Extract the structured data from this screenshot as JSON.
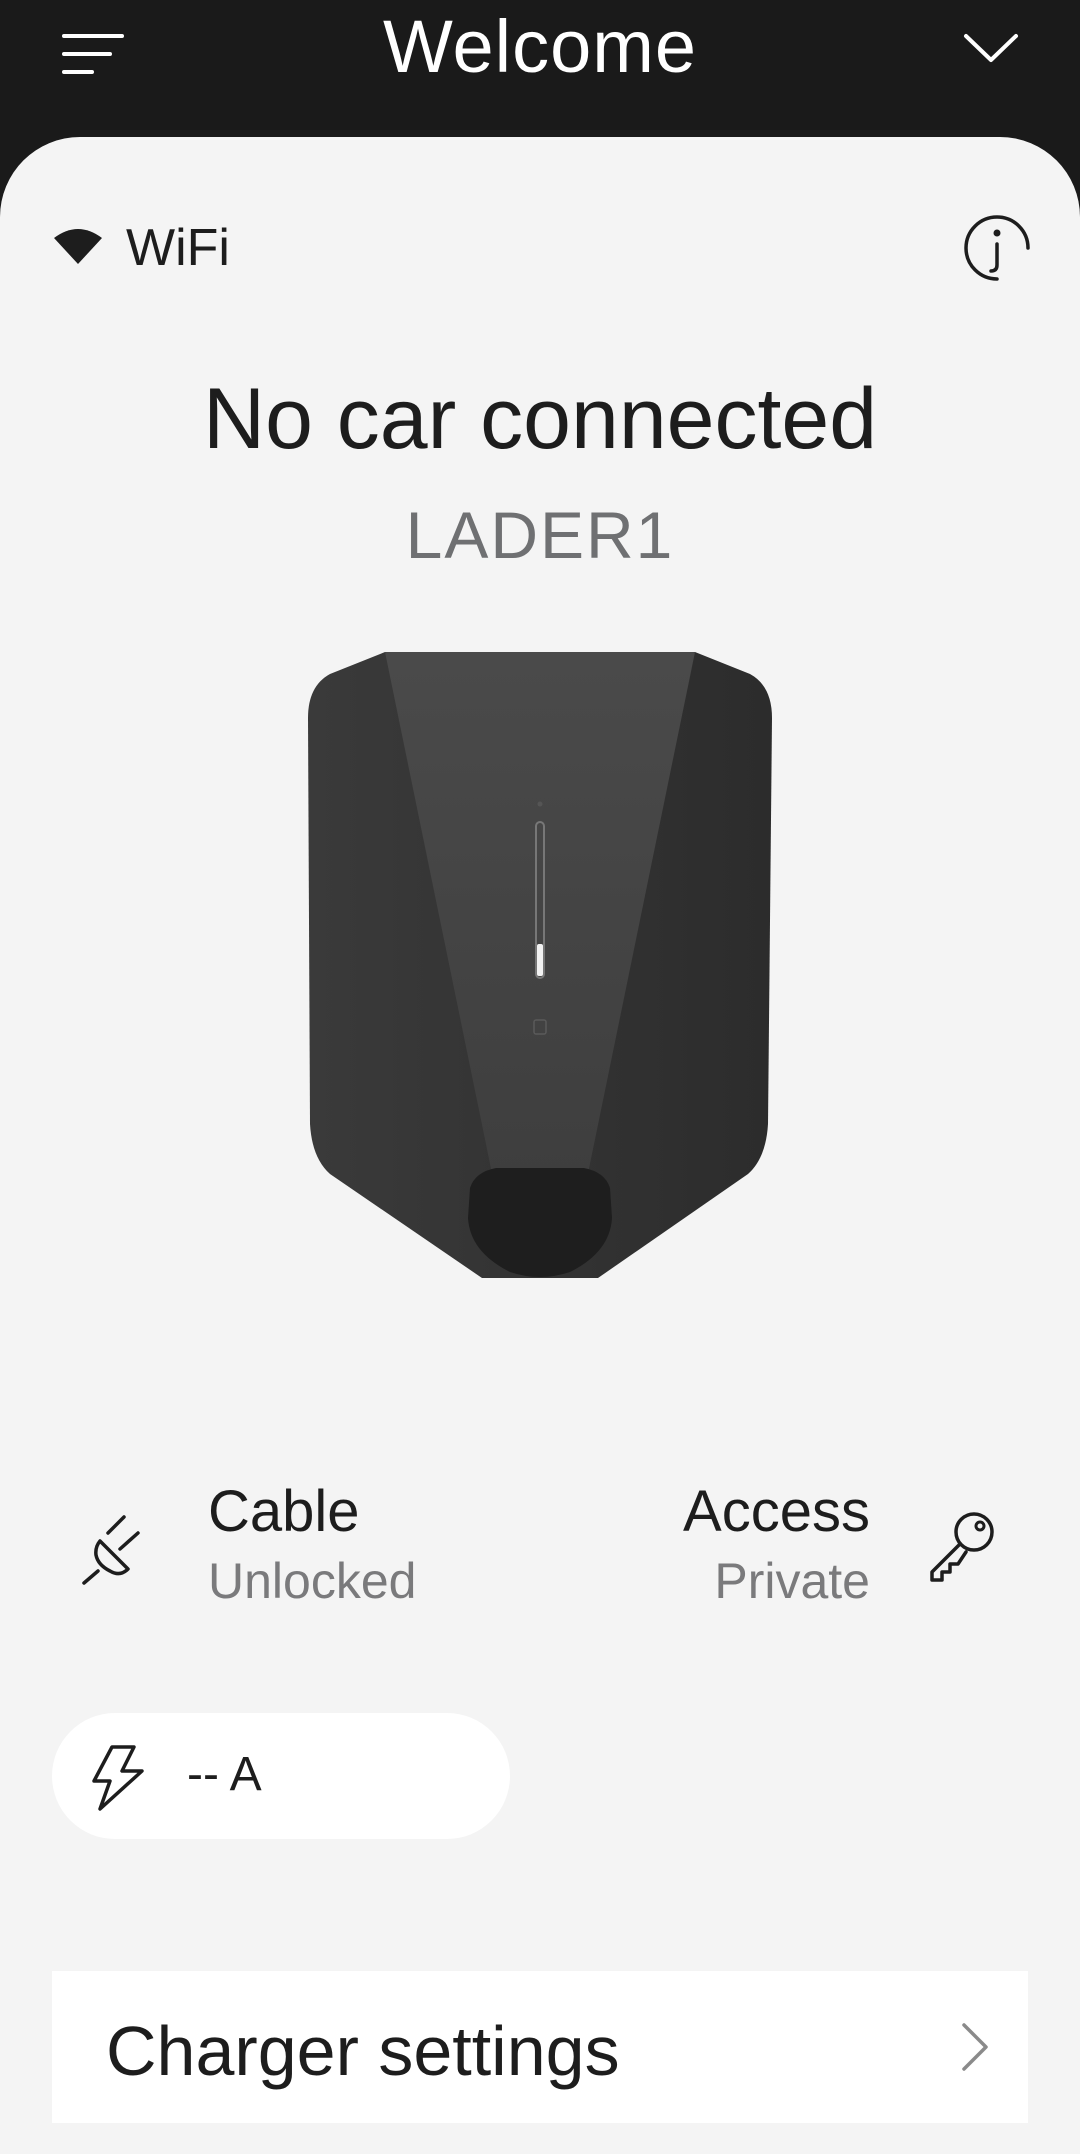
{
  "header": {
    "title": "Welcome",
    "menu_icon": "menu-icon",
    "expand_icon": "chevron-down-icon"
  },
  "connection": {
    "icon": "wifi-icon",
    "label": "WiFi"
  },
  "info_icon": "info-icon",
  "status": {
    "title": "No car connected",
    "charger_name": "LADER1"
  },
  "cable": {
    "icon": "plug-icon",
    "title": "Cable",
    "value": "Unlocked"
  },
  "access": {
    "icon": "key-icon",
    "title": "Access",
    "value": "Private"
  },
  "current": {
    "icon": "lightning-icon",
    "value": "-- A"
  },
  "settings": {
    "label": "Charger settings",
    "icon": "chevron-right-icon"
  },
  "colors": {
    "header_bg": "#1a1a1a",
    "card_bg": "#f4f4f4",
    "text_primary": "#1d1d1d",
    "text_secondary": "#7a7a7c",
    "surface": "#ffffff"
  }
}
